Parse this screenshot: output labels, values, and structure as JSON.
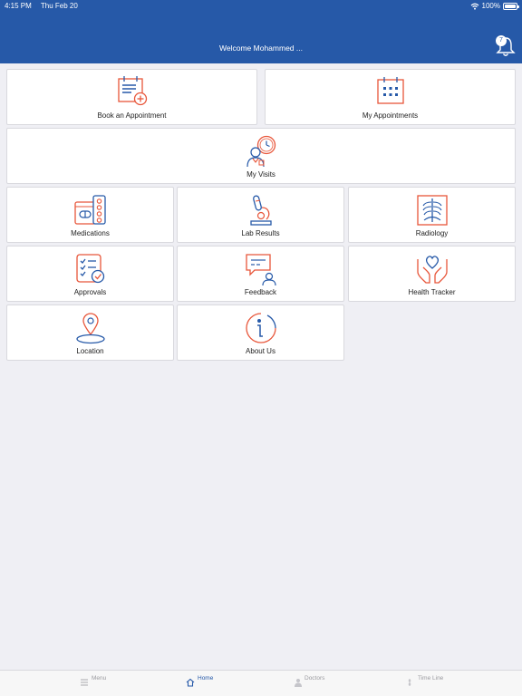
{
  "status_bar": {
    "time": "4:15 PM",
    "date": "Thu Feb 20",
    "battery_text": "100%",
    "battery_level": 1.0
  },
  "header": {
    "welcome": "Welcome Mohammed ...",
    "notification_count": "7"
  },
  "tiles": {
    "book_appointment": "Book an Appointment",
    "my_appointments": "My Appointments",
    "my_visits": "My Visits",
    "medications": "Medications",
    "lab_results": "Lab Results",
    "radiology": "Radiology",
    "approvals": "Approvals",
    "feedback": "Feedback",
    "health_tracker": "Health Tracker",
    "location": "Location",
    "about_us": "About Us"
  },
  "tabbar": {
    "menu": "Menu",
    "home": "Home",
    "doctors": "Doctors",
    "timeline": "Time Line"
  },
  "colors": {
    "brand_blue": "#2659a8",
    "accent_orange": "#e8563a",
    "background": "#efeff4"
  }
}
